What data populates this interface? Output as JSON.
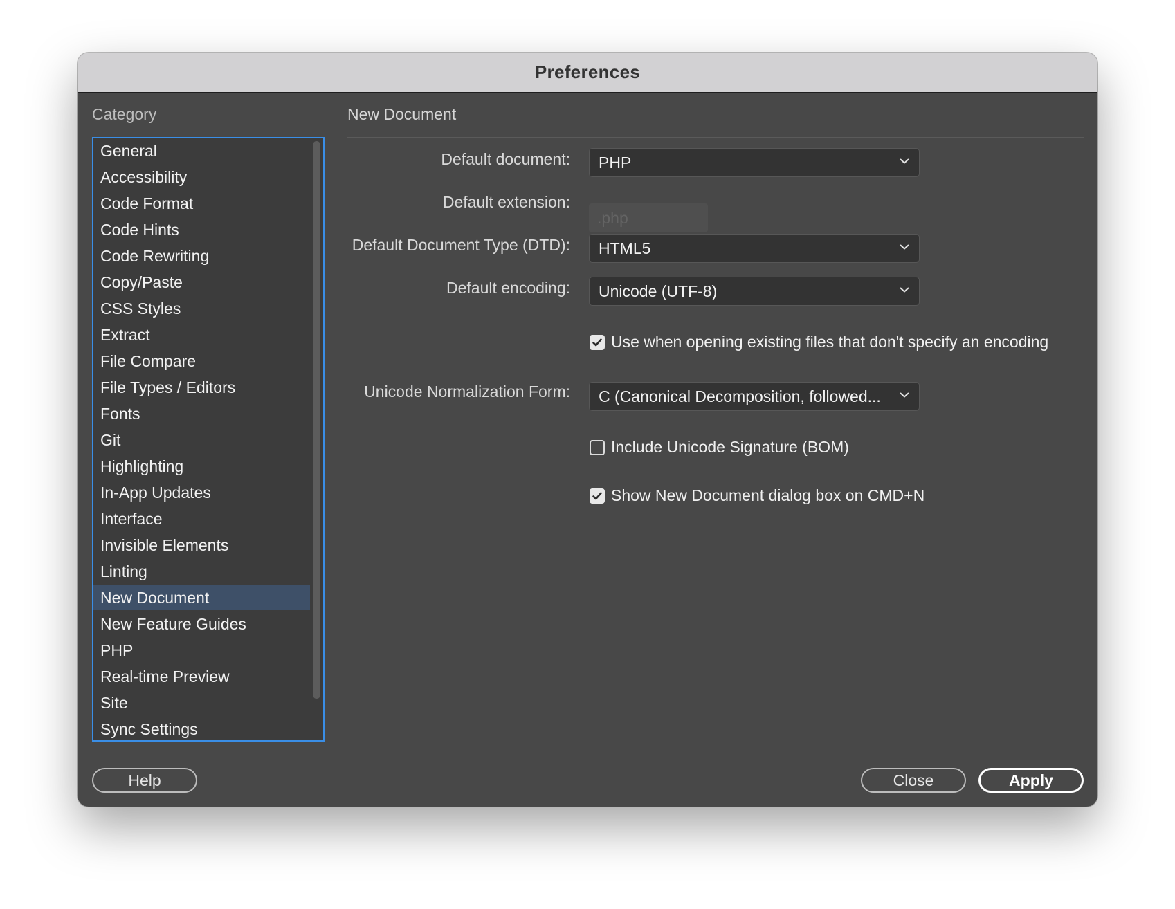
{
  "window": {
    "title": "Preferences"
  },
  "category": {
    "label": "Category",
    "items": [
      "General",
      "Accessibility",
      "Code Format",
      "Code Hints",
      "Code Rewriting",
      "Copy/Paste",
      "CSS Styles",
      "Extract",
      "File Compare",
      "File Types / Editors",
      "Fonts",
      "Git",
      "Highlighting",
      "In-App Updates",
      "Interface",
      "Invisible Elements",
      "Linting",
      "New Document",
      "New Feature Guides",
      "PHP",
      "Real-time Preview",
      "Site",
      "Sync Settings"
    ],
    "selected": "New Document"
  },
  "panel": {
    "title": "New Document",
    "default_document": {
      "label": "Default document:",
      "value": "PHP",
      "icon": "chevron-down-icon"
    },
    "default_extension": {
      "label": "Default extension:",
      "placeholder": ".php"
    },
    "default_dtd": {
      "label": "Default Document Type (DTD):",
      "value": "HTML5"
    },
    "default_encoding": {
      "label": "Default encoding:",
      "value": "Unicode (UTF-8)"
    },
    "use_encoding_checkbox": {
      "label": "Use when opening existing files that don't specify an encoding",
      "checked": true
    },
    "normalization": {
      "label": "Unicode Normalization Form:",
      "value": "C (Canonical Decomposition, followed..."
    },
    "bom_checkbox": {
      "label": "Include Unicode Signature (BOM)",
      "checked": false
    },
    "show_dialog_checkbox": {
      "label": "Show New Document dialog box on CMD+N",
      "checked": true
    }
  },
  "buttons": {
    "help": "Help",
    "close": "Close",
    "apply": "Apply"
  },
  "colors": {
    "selection": "#3e5068",
    "focus_ring": "#3a8ee6",
    "background": "#484848"
  }
}
